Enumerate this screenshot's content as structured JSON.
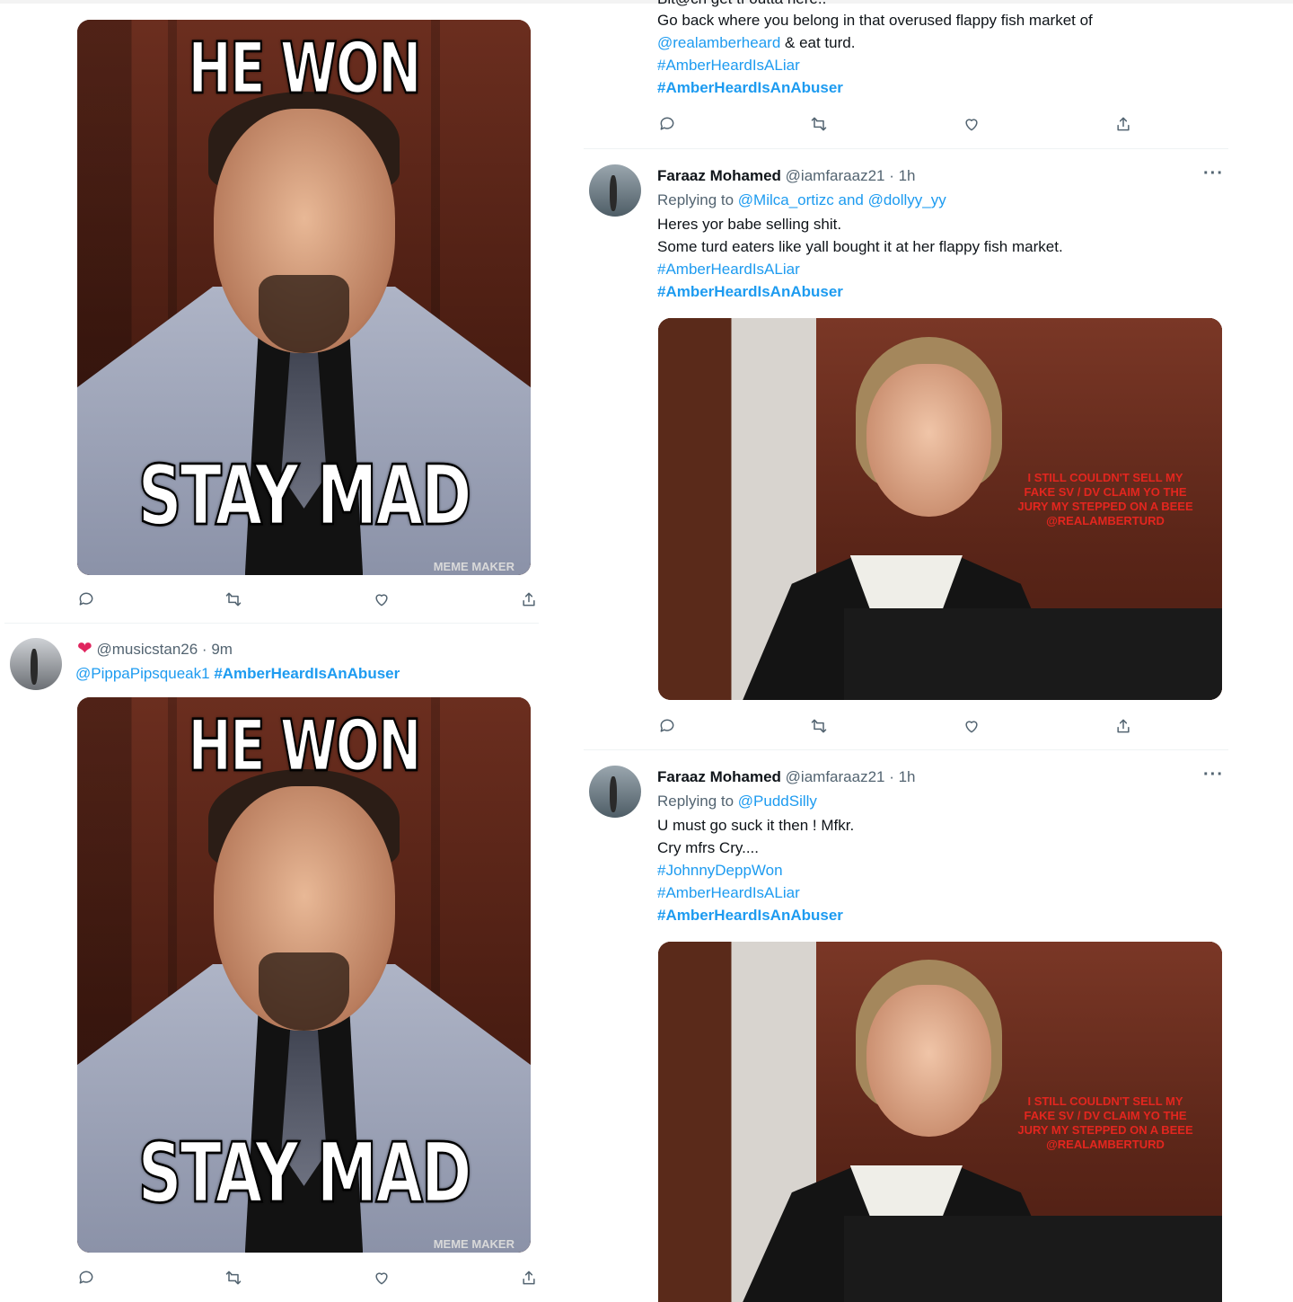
{
  "left": {
    "meme1": {
      "top_text": "HE WON",
      "bottom_text": "STAY MAD",
      "watermark": "MEME MAKER"
    },
    "reply_tweet": {
      "handle": "@musicstan26",
      "sep": " · ",
      "time": "9m",
      "mention": "@PippaPipsqueak1",
      "hashtag": "#AmberHeardIsAnAbuser"
    },
    "meme2": {
      "top_text": "HE WON",
      "bottom_text": "STAY MAD",
      "watermark": "MEME MAKER"
    }
  },
  "right": {
    "tweet0": {
      "partial_line": "Bit@ch get tf outta here..",
      "line1": "Go back where you belong in that overused flappy fish market of",
      "mention": "@realamberheard",
      "line2_rest": " & eat turd.",
      "tag1": "#AmberHeardIsALiar",
      "tag2": "#AmberHeardIsAnAbuser"
    },
    "tweet1": {
      "name": "Faraaz Mohamed",
      "handle": "@iamfaraaz21",
      "sep": " · ",
      "time": "1h",
      "replying_prefix": "Replying to ",
      "replying_to": "@Milca_ortizc and @dollyy_yy",
      "body1": "Heres yor babe selling shit.",
      "body2": "Some turd eaters like yall bought it at her flappy fish market.",
      "tag1": "#AmberHeardIsALiar",
      "tag2": "#AmberHeardIsAnAbuser",
      "image_caption": "I STILL COULDN'T SELL MY FAKE SV / DV CLAIM YO THE JURY MY STEPPED ON A BEEE @REALAMBERTURD"
    },
    "tweet2": {
      "name": "Faraaz Mohamed",
      "handle": "@iamfaraaz21",
      "sep": " · ",
      "time": "1h",
      "replying_prefix": "Replying to ",
      "replying_to": "@PuddSilly",
      "body1": "U must go suck it then ! Mfkr.",
      "body2": "Cry mfrs Cry....",
      "tag0": "#JohnnyDeppWon",
      "tag1": "#AmberHeardIsALiar",
      "tag2": "#AmberHeardIsAnAbuser",
      "image_caption": "I STILL COULDN'T SELL MY FAKE SV / DV CLAIM YO THE JURY MY STEPPED ON A BEEE @REALAMBERTURD"
    }
  },
  "more_label": "···",
  "icons": [
    "reply-icon",
    "retweet-icon",
    "like-icon",
    "share-icon",
    "more-icon"
  ]
}
